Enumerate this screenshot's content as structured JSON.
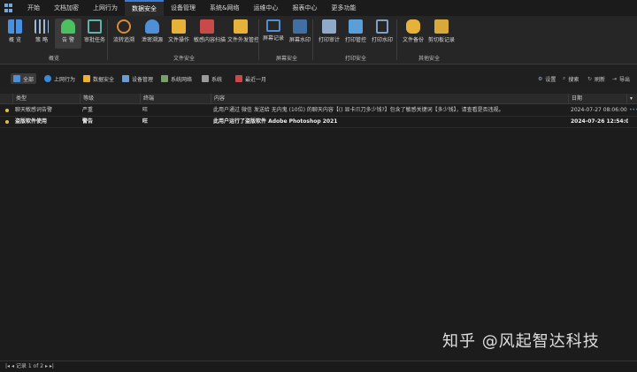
{
  "menu": {
    "items": [
      "开始",
      "文档加密",
      "上网行为",
      "数据安全",
      "设备管理",
      "系统&网络",
      "运维中心",
      "报表中心",
      "更多功能"
    ],
    "active_index": 3
  },
  "ribbon": {
    "groups": [
      {
        "title": "概览",
        "buttons": [
          "概 览",
          "策 略",
          "告 警",
          "审批任务"
        ]
      },
      {
        "title": "文件安全",
        "buttons": [
          "流转追溯",
          "泄密溯源",
          "文件操作",
          "敏感内容扫描",
          "文件外发管控"
        ]
      },
      {
        "title": "屏幕安全",
        "buttons": [
          "屏幕记录",
          "屏幕水印"
        ]
      },
      {
        "title": "打印安全",
        "buttons": [
          "打印审计",
          "打印管控",
          "打印水印"
        ]
      },
      {
        "title": "其他安全",
        "buttons": [
          "文件备份",
          "剪切板记录"
        ]
      }
    ],
    "selected_button": "告 警"
  },
  "filters": {
    "tabs": [
      "全部",
      "上网行为",
      "数据安全",
      "设备管理",
      "系统网络",
      "系统"
    ],
    "date_range": "最近一月",
    "right_actions": [
      "设置",
      "搜索",
      "刷新",
      "导出"
    ]
  },
  "table": {
    "columns": [
      "类型",
      "等级",
      "终端",
      "内容",
      "日期"
    ],
    "rows": [
      {
        "type": "聊天敏感词告警",
        "level": "严重",
        "terminal": "旺",
        "content": "此用户通过 微信 发送给 无内鬼 (10位) 的聊天内容【() 显卡爪刀多少钱?】包含了敏感关键词【多少钱】，请查看是否违规。",
        "date": "2024-07-27 08:06:00",
        "dot_color": "#e0c341",
        "bold": false
      },
      {
        "type": "盗版软件使用",
        "level": "警告",
        "terminal": "旺",
        "content": "此用户运行了盗版软件 Adobe Photoshop 2021",
        "date": "2024-07-26 12:54:07",
        "dot_color": "#e0c341",
        "bold": true
      }
    ]
  },
  "status": {
    "text": "记录 1 of 2"
  },
  "watermark": {
    "text": "知乎 @风起智达科技"
  },
  "colors": {
    "accent": "#3a7bd5",
    "background": "#202020"
  }
}
